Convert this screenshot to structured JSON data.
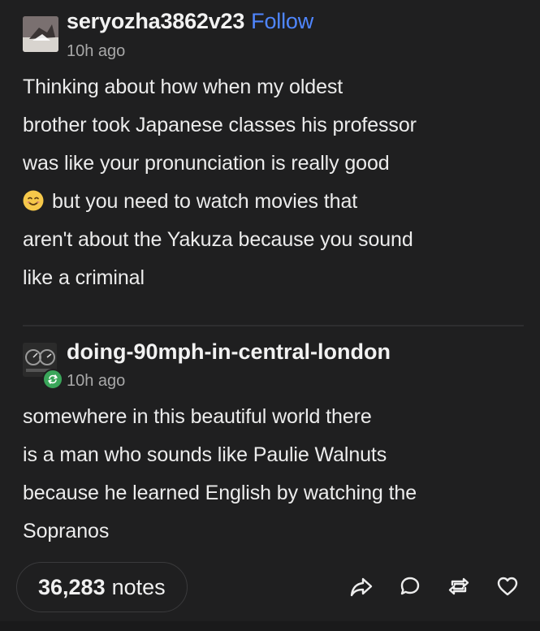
{
  "post": {
    "original": {
      "username": "seryozha3862v23",
      "follow_label": "Follow",
      "timestamp": "10h ago",
      "lines": [
        "Thinking about how when my oldest",
        "brother took Japanese classes his professor",
        "was like your pronunciation is really good",
        "but you need to watch movies that",
        "aren't about the Yakuza because you sound",
        "like a criminal"
      ],
      "emoji": "smiling-face-emoji"
    },
    "reblog": {
      "username": "doing-90mph-in-central-london",
      "timestamp": "10h ago",
      "lines": [
        "somewhere in this beautiful world there",
        "is a man who sounds like Paulie Walnuts",
        "because he learned English by watching the",
        "Sopranos"
      ]
    },
    "footer": {
      "notes_count": "36,283",
      "notes_label": "notes",
      "actions": [
        "share-icon",
        "reply-icon",
        "reblog-icon",
        "like-icon"
      ]
    }
  },
  "colors": {
    "background": "#1f1f20",
    "text": "#ececec",
    "muted": "#a8a8a8",
    "accent": "#4f86ff",
    "reblog_badge": "#3aa65a"
  }
}
